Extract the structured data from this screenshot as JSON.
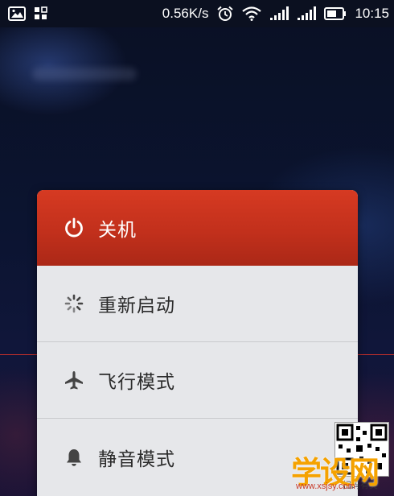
{
  "status_bar": {
    "left_icons": [
      "image-icon",
      "apps-grid-icon"
    ],
    "network_speed": "0.56K/s",
    "right_icons": [
      "alarm-clock-icon",
      "wifi-icon",
      "signal-bars-icon",
      "signal-bars-icon",
      "battery-icon"
    ],
    "time": "10:15"
  },
  "power_menu": {
    "items": [
      {
        "label": "关机",
        "icon": "power-icon",
        "highlighted": true
      },
      {
        "label": "重新启动",
        "icon": "spinner-icon",
        "highlighted": false
      },
      {
        "label": "飞行模式",
        "icon": "airplane-icon",
        "highlighted": false
      },
      {
        "label": "静音模式",
        "icon": "bell-icon",
        "highlighted": false
      }
    ]
  },
  "watermark": {
    "logo": "学设网",
    "url": "www.xsjsy.com",
    "caption": "扫码有奖"
  },
  "colors": {
    "primary_item": "#c8321d",
    "menu_background": "#e6e7ea",
    "status_bar": "#0b1020"
  }
}
